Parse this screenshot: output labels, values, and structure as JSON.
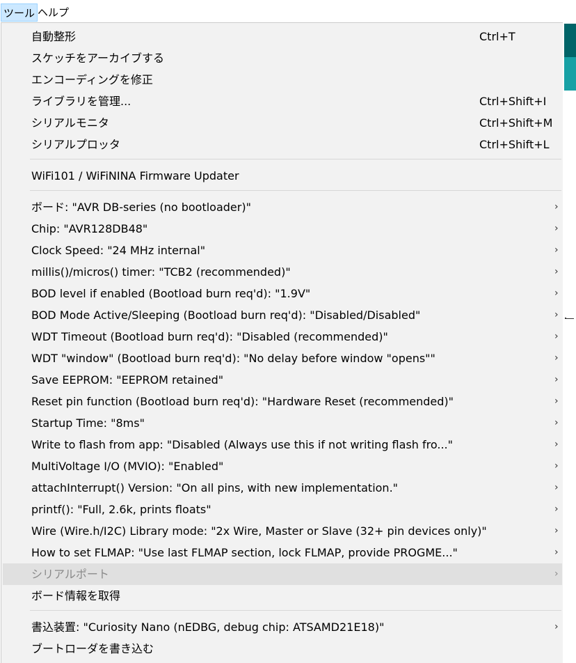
{
  "menubar": {
    "tools": "ツール",
    "help": "ヘルプ"
  },
  "menu": {
    "auto_format": "自動整形",
    "auto_format_shortcut": "Ctrl+T",
    "archive_sketch": "スケッチをアーカイブする",
    "fix_encoding": "エンコーディングを修正",
    "manage_libraries": "ライブラリを管理...",
    "manage_libraries_shortcut": "Ctrl+Shift+I",
    "serial_monitor": "シリアルモニタ",
    "serial_monitor_shortcut": "Ctrl+Shift+M",
    "serial_plotter": "シリアルプロッタ",
    "serial_plotter_shortcut": "Ctrl+Shift+L",
    "firmware_updater": "WiFi101 / WiFiNINA Firmware Updater",
    "board": "ボード: \"AVR DB-series (no bootloader)\"",
    "chip": "Chip: \"AVR128DB48\"",
    "clock_speed": "Clock Speed: \"24 MHz internal\"",
    "timer": "millis()/micros() timer: \"TCB2 (recommended)\"",
    "bod_level": "BOD level if enabled (Bootload burn req'd): \"1.9V\"",
    "bod_mode": "BOD Mode Active/Sleeping (Bootload burn req'd): \"Disabled/Disabled\"",
    "wdt_timeout": "WDT Timeout (Bootload burn req'd): \"Disabled (recommended)\"",
    "wdt_window": "WDT \"window\" (Bootload burn req'd): \"No delay before window \"opens\"\"",
    "save_eeprom": "Save EEPROM: \"EEPROM retained\"",
    "reset_pin": "Reset pin function (Bootload burn req'd): \"Hardware Reset (recommended)\"",
    "startup_time": "Startup Time: \"8ms\"",
    "write_flash": "Write to flash from app: \"Disabled (Always use this if not writing flash fro...\"",
    "multivoltage": "MultiVoltage I/O (MVIO): \"Enabled\"",
    "attach_interrupt": "attachInterrupt() Version: \"On all pins, with new implementation.\"",
    "printf": "printf(): \"Full, 2.6k, prints floats\"",
    "wire_mode": "Wire (Wire.h/I2C) Library mode: \"2x Wire, Master or Slave (32+ pin devices only)\"",
    "flmap": "How to set FLMAP: \"Use last FLMAP section, lock FLMAP, provide PROGME...\"",
    "serial_port": "シリアルポート",
    "board_info": "ボード情報を取得",
    "programmer": "書込装置: \"Curiosity Nano (nEDBG, debug chip: ATSAMD21E18)\"",
    "burn_bootloader": "ブートローダを書き込む",
    "submenu_arrow": "›"
  },
  "colors": {
    "menu_bg": "#f2f2f2",
    "active_menu_bg": "#cce8ff",
    "hover_bg": "#e0e0e0",
    "disabled_text": "#8a8a8a",
    "accent_teal": "#17a1a5",
    "accent_dark": "#006468"
  }
}
